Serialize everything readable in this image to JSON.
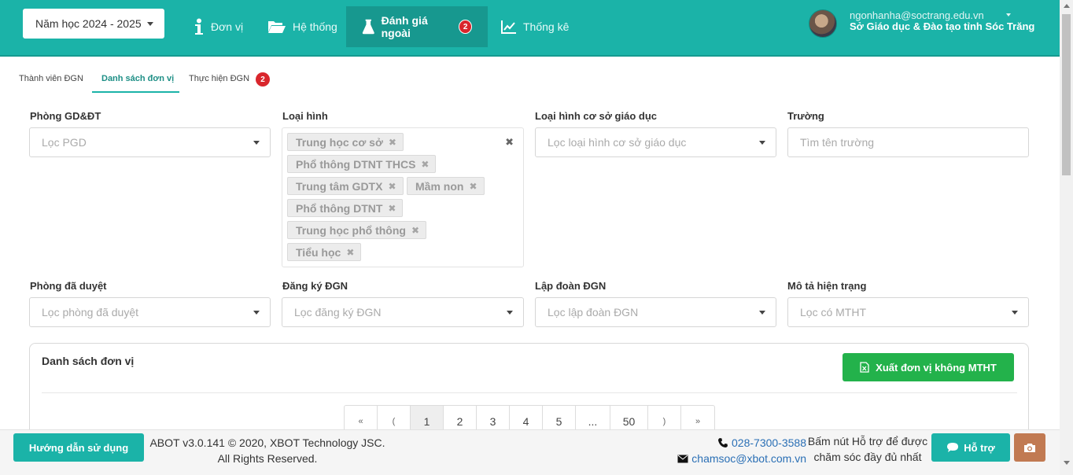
{
  "header": {
    "year_select": "Năm học 2024 - 2025",
    "nav": [
      {
        "label": "Đơn vị",
        "icon": "info-icon"
      },
      {
        "label": "Hệ thống",
        "icon": "folder-open-icon"
      },
      {
        "label": "Đánh giá ngoài",
        "icon": "flask-icon",
        "badge": "2",
        "active": true
      },
      {
        "label": "Thống kê",
        "icon": "line-chart-icon"
      }
    ],
    "user_email": "ngonhanha@soctrang.edu.vn",
    "user_org": "Sở Giáo dục & Đào tạo tỉnh Sóc Trăng"
  },
  "subtabs": [
    {
      "label": "Thành viên ĐGN"
    },
    {
      "label": "Danh sách đơn vị",
      "active": true
    },
    {
      "label": "Thực hiện ĐGN",
      "badge": "2"
    }
  ],
  "filters": {
    "phong": {
      "label": "Phòng GD&ĐT",
      "placeholder": "Lọc PGD"
    },
    "loai_hinh": {
      "label": "Loại hình",
      "tags": [
        "Trung học cơ sở",
        "Phổ thông DTNT THCS",
        "Trung tâm GDTX",
        "Mầm non",
        "Phổ thông DTNT",
        "Trung học phổ thông",
        "Tiểu học"
      ],
      "clear": "✖"
    },
    "loai_hinh_co_so": {
      "label": "Loại hình cơ sở giáo dục",
      "placeholder": "Lọc loại hình cơ sở giáo dục"
    },
    "truong": {
      "label": "Trường",
      "placeholder": "Tìm tên trường"
    },
    "phong_duyet": {
      "label": "Phòng đã duyệt",
      "placeholder": "Lọc phòng đã duyệt"
    },
    "dang_ky": {
      "label": "Đăng ký ĐGN",
      "placeholder": "Lọc đăng ký ĐGN"
    },
    "lap_doan": {
      "label": "Lập đoàn ĐGN",
      "placeholder": "Lọc lập đoàn ĐGN"
    },
    "mo_ta": {
      "label": "Mô tả hiện trạng",
      "placeholder": "Lọc có MTHT"
    }
  },
  "panel": {
    "title": "Danh sách đơn vị",
    "export_label": "Xuất đơn vị không MTHT",
    "pagination": [
      "«",
      "(",
      "1",
      "2",
      "3",
      "4",
      "5",
      "...",
      "50",
      ")",
      "»"
    ],
    "current_page": "1"
  },
  "footer": {
    "guide_label": "Hướng dẫn sử dụng",
    "copyright_line1": "ABOT v3.0.141 © 2020, XBOT Technology JSC.",
    "copyright_line2": "All Rights Reserved.",
    "phone": "028-7300-3588",
    "email": "chamsoc@xbot.com.vn",
    "support_text_line1": "Bấm nút Hỗ trợ để được",
    "support_text_line2": "chăm sóc đầy đủ nhất",
    "support_label": "Hỗ trợ"
  },
  "colors": {
    "primary": "#1bb3a8",
    "success": "#23b24b",
    "danger": "#d9262c",
    "camera": "#c17a52"
  }
}
